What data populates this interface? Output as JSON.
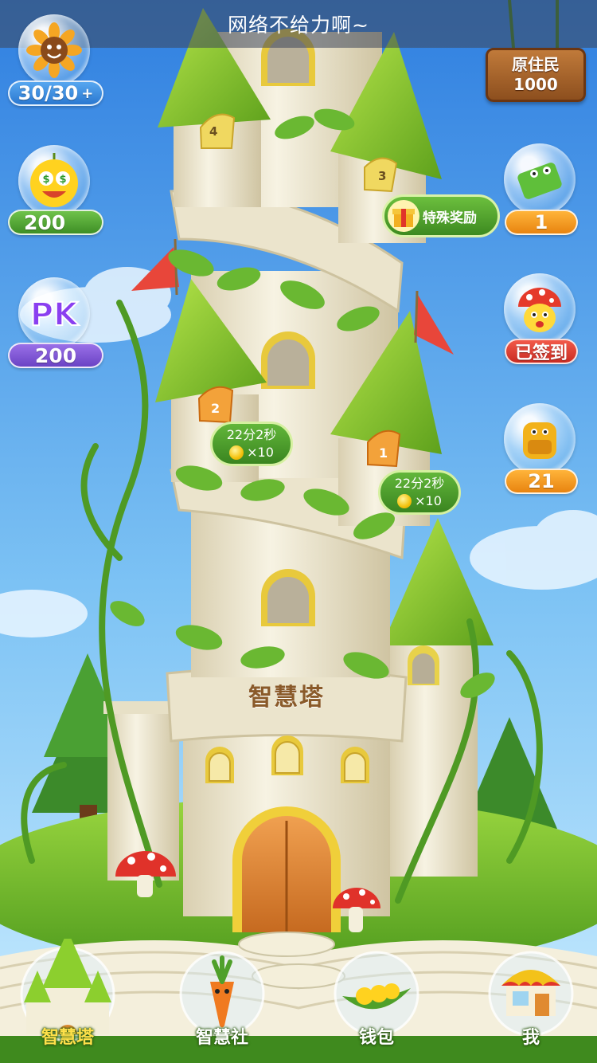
{
  "toast": {
    "message": "网络不给力啊~"
  },
  "stats": {
    "energy": {
      "value": "30/30",
      "plus": "+",
      "icon": "sunflower-icon"
    },
    "coins": {
      "value": "200",
      "icon": "money-face-icon"
    },
    "pk": {
      "value": "200",
      "icon_text": "PK"
    }
  },
  "native": {
    "title": "原住民",
    "value": "1000"
  },
  "right_items": {
    "tickets": {
      "value": "1",
      "icon": "green-envelope-icon"
    },
    "checkin": {
      "status": "已签到",
      "icon": "mushroom-face-icon"
    },
    "backpack": {
      "value": "21",
      "icon": "backpack-icon"
    }
  },
  "special_reward": {
    "label": "特殊奖励",
    "icon": "gift-icon"
  },
  "timers": [
    {
      "time": "22分2秒",
      "multiplier": "×10"
    },
    {
      "time": "22分2秒",
      "multiplier": "×10"
    }
  ],
  "doors": [
    "4",
    "3",
    "2",
    "1"
  ],
  "tower": {
    "title": "智慧塔"
  },
  "nav": [
    {
      "label": "智慧塔",
      "icon": "castle-icon",
      "active": true
    },
    {
      "label": "智慧社",
      "icon": "carrot-icon",
      "active": false
    },
    {
      "label": "钱包",
      "icon": "pea-pod-icon",
      "active": false
    },
    {
      "label": "我",
      "icon": "shop-icon",
      "active": false
    }
  ],
  "colors": {
    "sky_top": "#2f7fe0",
    "sky_bottom": "#bfe6ff",
    "grass": "#7cc13a",
    "roof": "#8ccf2e",
    "wall": "#f2ecd8"
  }
}
